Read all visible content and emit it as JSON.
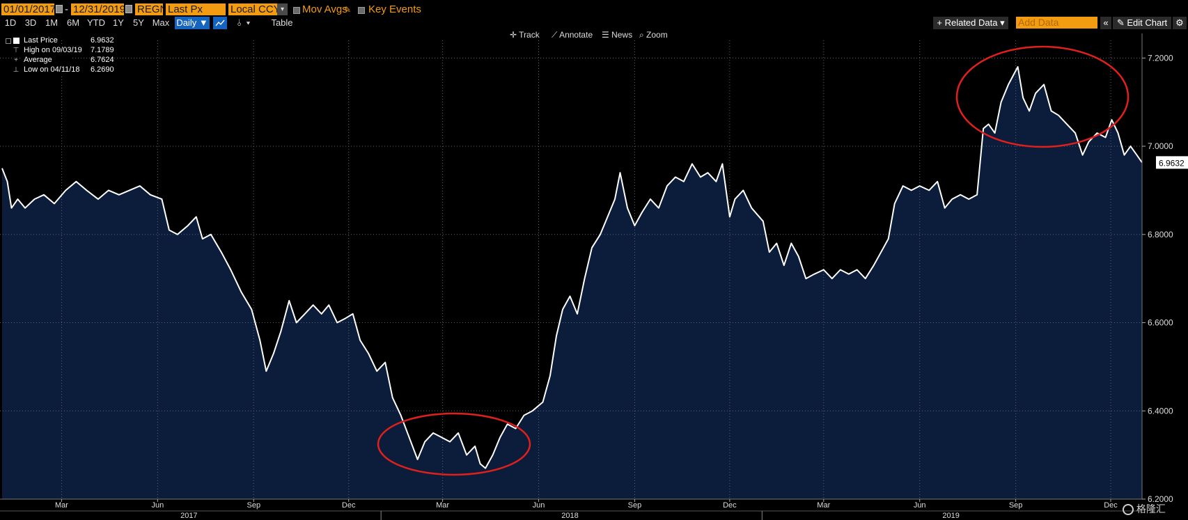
{
  "toolbar": {
    "start_date": "01/01/2017",
    "separator": "-",
    "end_date": "12/31/2019",
    "ticker": "REGN",
    "field": "Last Px",
    "currency": "Local CCY",
    "mov_avgs": "Mov Avgs",
    "key_events": "Key Events",
    "periods": [
      "1D",
      "3D",
      "1M",
      "6M",
      "YTD",
      "1Y",
      "5Y",
      "Max"
    ],
    "frequency": "Daily ▼",
    "table_label": "Table",
    "related_data": "+ Related Data ▾",
    "add_data_placeholder": "Add Data",
    "collapse_icon": "«",
    "edit_chart": "✎ Edit Chart",
    "settings_icon": "⚙",
    "track": "✛ Track",
    "annotate": "⟋ Annotate",
    "news": "☰ News",
    "zoom": "⌕ Zoom"
  },
  "legend": {
    "last_price_label": "Last Price",
    "last_price_value": "6.9632",
    "high_label": "High on 09/03/19",
    "high_value": "7.1789",
    "average_label": "Average",
    "average_value": "6.7624",
    "low_label": "Low on 04/11/18",
    "low_value": "6.2690"
  },
  "watermark": "格隆汇",
  "colors": {
    "background": "#000000",
    "area_fill": "#0b1d3a",
    "line": "#ffffff",
    "accent": "#f39c12",
    "highlight_circle": "#e0201c",
    "active_tab": "#1565c0"
  },
  "chart_data": {
    "type": "area",
    "ylim": [
      6.2,
      7.24
    ],
    "x_range": [
      "2017-01-01",
      "2019-12-31"
    ],
    "yticks": [
      "6.2000",
      "6.4000",
      "6.6000",
      "6.8000",
      "7.0000",
      "7.2000"
    ],
    "month_ticks": [
      {
        "label": "Mar",
        "date": "2017-03-01"
      },
      {
        "label": "Jun",
        "date": "2017-06-01"
      },
      {
        "label": "Sep",
        "date": "2017-09-01"
      },
      {
        "label": "Dec",
        "date": "2017-12-01"
      },
      {
        "label": "Mar",
        "date": "2018-03-01"
      },
      {
        "label": "Jun",
        "date": "2018-06-01"
      },
      {
        "label": "Sep",
        "date": "2018-09-01"
      },
      {
        "label": "Dec",
        "date": "2018-12-01"
      },
      {
        "label": "Mar",
        "date": "2019-03-01"
      },
      {
        "label": "Jun",
        "date": "2019-06-01"
      },
      {
        "label": "Sep",
        "date": "2019-09-01"
      },
      {
        "label": "Dec",
        "date": "2019-12-01"
      }
    ],
    "year_labels": [
      {
        "label": "2017",
        "date": "2017-07-01"
      },
      {
        "label": "2018",
        "date": "2018-07-01"
      },
      {
        "label": "2019",
        "date": "2019-07-01"
      }
    ],
    "last_value_label": "6.9632",
    "grid": true,
    "series": [
      {
        "values": [
          [
            "2017-01-03",
            6.95
          ],
          [
            "2017-01-08",
            6.92
          ],
          [
            "2017-01-12",
            6.86
          ],
          [
            "2017-01-18",
            6.88
          ],
          [
            "2017-01-25",
            6.86
          ],
          [
            "2017-02-03",
            6.88
          ],
          [
            "2017-02-12",
            6.89
          ],
          [
            "2017-02-22",
            6.87
          ],
          [
            "2017-03-05",
            6.9
          ],
          [
            "2017-03-15",
            6.92
          ],
          [
            "2017-03-25",
            6.9
          ],
          [
            "2017-04-05",
            6.88
          ],
          [
            "2017-04-15",
            6.9
          ],
          [
            "2017-04-25",
            6.89
          ],
          [
            "2017-05-05",
            6.9
          ],
          [
            "2017-05-15",
            6.91
          ],
          [
            "2017-05-25",
            6.89
          ],
          [
            "2017-06-05",
            6.88
          ],
          [
            "2017-06-12",
            6.81
          ],
          [
            "2017-06-20",
            6.8
          ],
          [
            "2017-06-30",
            6.82
          ],
          [
            "2017-07-08",
            6.84
          ],
          [
            "2017-07-14",
            6.79
          ],
          [
            "2017-07-22",
            6.8
          ],
          [
            "2017-08-01",
            6.76
          ],
          [
            "2017-08-10",
            6.72
          ],
          [
            "2017-08-20",
            6.67
          ],
          [
            "2017-08-30",
            6.63
          ],
          [
            "2017-09-07",
            6.56
          ],
          [
            "2017-09-13",
            6.49
          ],
          [
            "2017-09-20",
            6.53
          ],
          [
            "2017-09-27",
            6.58
          ],
          [
            "2017-10-05",
            6.65
          ],
          [
            "2017-10-12",
            6.6
          ],
          [
            "2017-10-20",
            6.62
          ],
          [
            "2017-10-28",
            6.64
          ],
          [
            "2017-11-05",
            6.62
          ],
          [
            "2017-11-12",
            6.64
          ],
          [
            "2017-11-20",
            6.6
          ],
          [
            "2017-11-28",
            6.61
          ],
          [
            "2017-12-05",
            6.62
          ],
          [
            "2017-12-12",
            6.56
          ],
          [
            "2017-12-20",
            6.53
          ],
          [
            "2017-12-28",
            6.49
          ],
          [
            "2018-01-05",
            6.51
          ],
          [
            "2018-01-12",
            6.43
          ],
          [
            "2018-01-20",
            6.39
          ],
          [
            "2018-01-28",
            6.34
          ],
          [
            "2018-02-05",
            6.29
          ],
          [
            "2018-02-12",
            6.33
          ],
          [
            "2018-02-20",
            6.35
          ],
          [
            "2018-02-28",
            6.34
          ],
          [
            "2018-03-08",
            6.33
          ],
          [
            "2018-03-16",
            6.35
          ],
          [
            "2018-03-24",
            6.3
          ],
          [
            "2018-04-01",
            6.32
          ],
          [
            "2018-04-06",
            6.28
          ],
          [
            "2018-04-11",
            6.27
          ],
          [
            "2018-04-18",
            6.3
          ],
          [
            "2018-04-25",
            6.34
          ],
          [
            "2018-05-02",
            6.37
          ],
          [
            "2018-05-10",
            6.36
          ],
          [
            "2018-05-18",
            6.39
          ],
          [
            "2018-05-26",
            6.4
          ],
          [
            "2018-06-05",
            6.42
          ],
          [
            "2018-06-12",
            6.48
          ],
          [
            "2018-06-18",
            6.57
          ],
          [
            "2018-06-24",
            6.63
          ],
          [
            "2018-07-01",
            6.66
          ],
          [
            "2018-07-08",
            6.62
          ],
          [
            "2018-07-15",
            6.7
          ],
          [
            "2018-07-22",
            6.77
          ],
          [
            "2018-07-30",
            6.8
          ],
          [
            "2018-08-06",
            6.84
          ],
          [
            "2018-08-13",
            6.88
          ],
          [
            "2018-08-18",
            6.94
          ],
          [
            "2018-08-25",
            6.86
          ],
          [
            "2018-09-01",
            6.82
          ],
          [
            "2018-09-08",
            6.85
          ],
          [
            "2018-09-16",
            6.88
          ],
          [
            "2018-09-24",
            6.86
          ],
          [
            "2018-10-02",
            6.91
          ],
          [
            "2018-10-10",
            6.93
          ],
          [
            "2018-10-18",
            6.92
          ],
          [
            "2018-10-26",
            6.96
          ],
          [
            "2018-11-03",
            6.93
          ],
          [
            "2018-11-10",
            6.94
          ],
          [
            "2018-11-18",
            6.92
          ],
          [
            "2018-11-24",
            6.96
          ],
          [
            "2018-12-01",
            6.84
          ],
          [
            "2018-12-06",
            6.88
          ],
          [
            "2018-12-14",
            6.9
          ],
          [
            "2018-12-22",
            6.86
          ],
          [
            "2019-01-02",
            6.83
          ],
          [
            "2019-01-08",
            6.76
          ],
          [
            "2019-01-15",
            6.78
          ],
          [
            "2019-01-22",
            6.73
          ],
          [
            "2019-01-29",
            6.78
          ],
          [
            "2019-02-05",
            6.75
          ],
          [
            "2019-02-12",
            6.7
          ],
          [
            "2019-02-20",
            6.71
          ],
          [
            "2019-03-01",
            6.72
          ],
          [
            "2019-03-09",
            6.7
          ],
          [
            "2019-03-17",
            6.72
          ],
          [
            "2019-03-25",
            6.71
          ],
          [
            "2019-04-02",
            6.72
          ],
          [
            "2019-04-10",
            6.7
          ],
          [
            "2019-04-18",
            6.73
          ],
          [
            "2019-04-25",
            6.76
          ],
          [
            "2019-05-02",
            6.79
          ],
          [
            "2019-05-08",
            6.87
          ],
          [
            "2019-05-16",
            6.91
          ],
          [
            "2019-05-24",
            6.9
          ],
          [
            "2019-06-01",
            6.91
          ],
          [
            "2019-06-10",
            6.9
          ],
          [
            "2019-06-18",
            6.92
          ],
          [
            "2019-06-25",
            6.86
          ],
          [
            "2019-07-02",
            6.88
          ],
          [
            "2019-07-10",
            6.89
          ],
          [
            "2019-07-18",
            6.88
          ],
          [
            "2019-07-26",
            6.89
          ],
          [
            "2019-08-01",
            7.04
          ],
          [
            "2019-08-06",
            7.05
          ],
          [
            "2019-08-12",
            7.03
          ],
          [
            "2019-08-18",
            7.1
          ],
          [
            "2019-08-25",
            7.14
          ],
          [
            "2019-09-03",
            7.18
          ],
          [
            "2019-09-08",
            7.11
          ],
          [
            "2019-09-14",
            7.08
          ],
          [
            "2019-09-20",
            7.12
          ],
          [
            "2019-09-28",
            7.14
          ],
          [
            "2019-10-05",
            7.08
          ],
          [
            "2019-10-12",
            7.07
          ],
          [
            "2019-10-20",
            7.05
          ],
          [
            "2019-10-28",
            7.03
          ],
          [
            "2019-11-04",
            6.98
          ],
          [
            "2019-11-10",
            7.01
          ],
          [
            "2019-11-18",
            7.03
          ],
          [
            "2019-11-26",
            7.02
          ],
          [
            "2019-12-02",
            7.06
          ],
          [
            "2019-12-08",
            7.03
          ],
          [
            "2019-12-14",
            6.98
          ],
          [
            "2019-12-20",
            7.0
          ],
          [
            "2019-12-26",
            6.98
          ],
          [
            "2019-12-31",
            6.9632
          ]
        ]
      }
    ]
  }
}
